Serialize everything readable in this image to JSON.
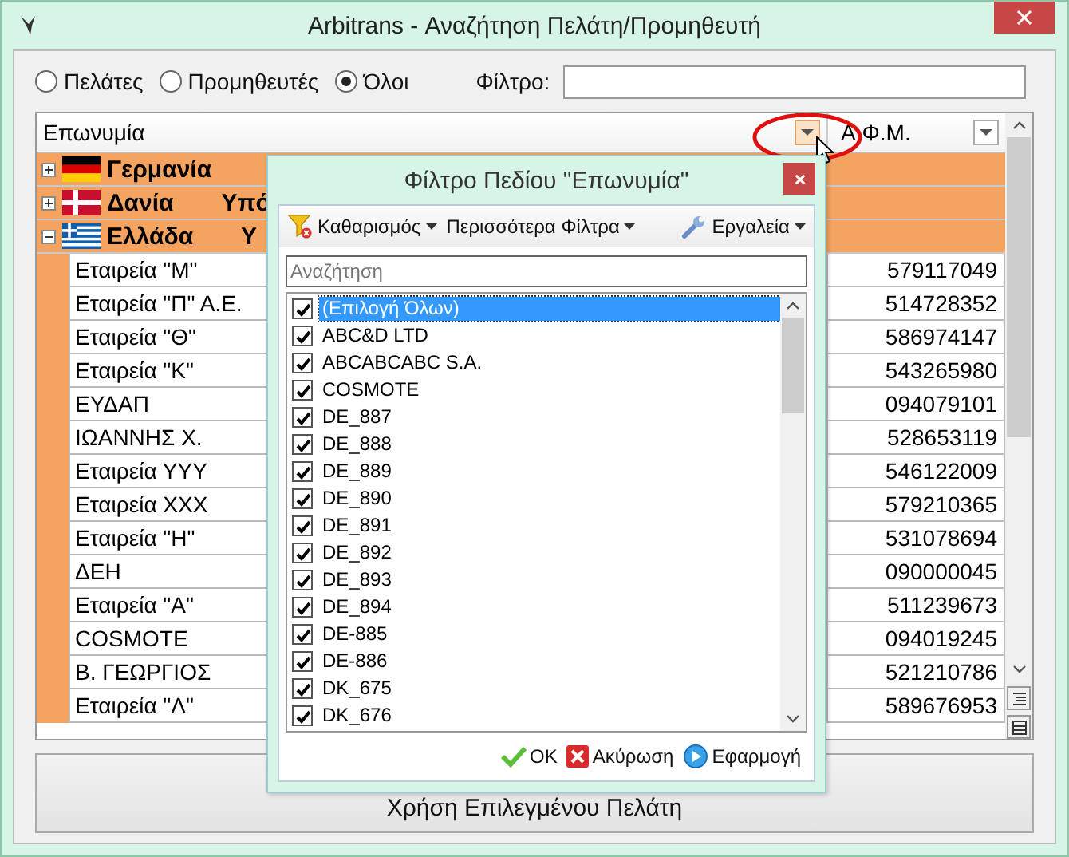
{
  "window": {
    "title": "Arbitrans - Αναζήτηση Πελάτη/Προμηθευτή"
  },
  "filter_mode": [
    {
      "label": "Πελάτες",
      "selected": false
    },
    {
      "label": "Προμηθευτές",
      "selected": false
    },
    {
      "label": "Όλοι",
      "selected": true
    }
  ],
  "filter": {
    "label": "Φίλτρο:"
  },
  "grid": {
    "columns": [
      {
        "label": "Επωνυμία",
        "active": true
      },
      {
        "label": "Α.Φ.Μ.",
        "active": false
      }
    ],
    "groups": [
      {
        "name": "Γερμανία",
        "kind": "germany",
        "expanded": false
      },
      {
        "name": "Δανία",
        "kind": "denmark",
        "expanded": false,
        "extra": "Υπό"
      },
      {
        "name": "Ελλάδα",
        "kind": "greece",
        "expanded": true,
        "extra": "Υ"
      }
    ],
    "rows": [
      {
        "name": "Εταιρεία \"Μ\"",
        "afm": "579117049"
      },
      {
        "name": "Εταιρεία \"Π\" Α.Ε.",
        "afm": "514728352"
      },
      {
        "name": "Εταιρεία \"Θ\"",
        "afm": "586974147"
      },
      {
        "name": "Εταιρεία \"Κ\"",
        "afm": "543265980"
      },
      {
        "name": "ΕΥΔΑΠ",
        "afm": "094079101"
      },
      {
        "name": "ΙΩΑΝΝΗΣ Χ.",
        "afm": "528653119"
      },
      {
        "name": "Εταιρεία ΥΥΥ",
        "afm": "546122009"
      },
      {
        "name": "Εταιρεία ΧΧΧ",
        "afm": "579210365"
      },
      {
        "name": "Εταιρεία \"Η\"",
        "afm": "531078694"
      },
      {
        "name": "ΔΕΗ",
        "afm": "090000045"
      },
      {
        "name": "Εταιρεία \"Α\"",
        "afm": "511239673"
      },
      {
        "name": "COSMOTE",
        "afm": "094019245"
      },
      {
        "name": "Β. ΓΕΩΡΓΙΟΣ",
        "afm": "521210786"
      },
      {
        "name": "Εταιρεία \"Λ\"",
        "afm": "589676953"
      }
    ]
  },
  "use_button": {
    "label": "Χρήση Επιλεγμένου Πελάτη"
  },
  "popup": {
    "title": "Φίλτρο Πεδίου \"Επωνυμία\"",
    "toolbar": [
      {
        "label": "Καθαρισμός",
        "kind": "clear"
      },
      {
        "label": "Περισσότερα Φίλτρα",
        "kind": "more"
      },
      {
        "label": "Εργαλεία",
        "kind": "tools"
      }
    ],
    "search": {
      "placeholder": "Αναζήτηση"
    },
    "items": [
      {
        "label": "(Επιλογή Όλων)",
        "checked": true,
        "selected": true
      },
      {
        "label": "ABC&D LTD",
        "checked": true,
        "selected": false
      },
      {
        "label": "ABCABCABC S.A.",
        "checked": true,
        "selected": false
      },
      {
        "label": "COSMOTE",
        "checked": true,
        "selected": false
      },
      {
        "label": "DE_887",
        "checked": true,
        "selected": false
      },
      {
        "label": "DE_888",
        "checked": true,
        "selected": false
      },
      {
        "label": "DE_889",
        "checked": true,
        "selected": false
      },
      {
        "label": "DE_890",
        "checked": true,
        "selected": false
      },
      {
        "label": "DE_891",
        "checked": true,
        "selected": false
      },
      {
        "label": "DE_892",
        "checked": true,
        "selected": false
      },
      {
        "label": "DE_893",
        "checked": true,
        "selected": false
      },
      {
        "label": "DE_894",
        "checked": true,
        "selected": false
      },
      {
        "label": "DE-885",
        "checked": true,
        "selected": false
      },
      {
        "label": "DE-886",
        "checked": true,
        "selected": false
      },
      {
        "label": "DK_675",
        "checked": true,
        "selected": false
      },
      {
        "label": "DK_676",
        "checked": true,
        "selected": false
      }
    ],
    "buttons": [
      {
        "label": "OK",
        "kind": "ok"
      },
      {
        "label": "Ακύρωση",
        "kind": "cancel"
      },
      {
        "label": "Εφαρμογή",
        "kind": "apply"
      }
    ]
  }
}
